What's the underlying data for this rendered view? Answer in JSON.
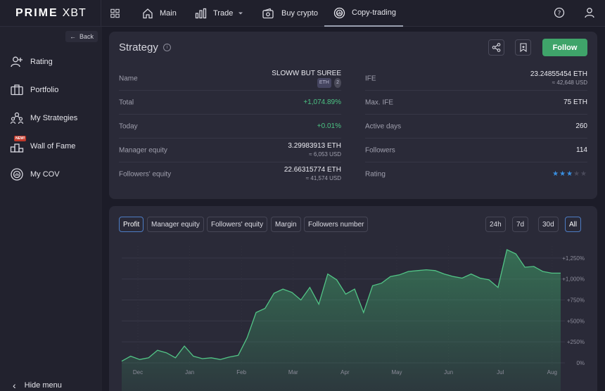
{
  "header": {
    "logo_left": "PRIME",
    "logo_right": "XBT",
    "nav": [
      {
        "label": "Main"
      },
      {
        "label": "Trade"
      },
      {
        "label": "Buy crypto"
      },
      {
        "label": "Copy-trading"
      }
    ]
  },
  "sidebar": {
    "back_label": "Back",
    "items": [
      {
        "label": "Rating"
      },
      {
        "label": "Portfolio"
      },
      {
        "label": "My Strategies"
      },
      {
        "label": "Wall of Fame",
        "badge": "NEW!"
      },
      {
        "label": "My COV"
      }
    ],
    "hide_menu": "Hide menu"
  },
  "strategy": {
    "title": "Strategy",
    "follow_label": "Follow",
    "left": [
      {
        "label": "Name",
        "value": "SLOWW BUT SUREE",
        "tags": [
          "ETH",
          "2"
        ]
      },
      {
        "label": "Total",
        "value": "+1,074.89%",
        "green": true
      },
      {
        "label": "Today",
        "value": "+0.01%",
        "green": true
      },
      {
        "label": "Manager equity",
        "value": "3.29983913 ETH",
        "sub": "≈ 6,053 USD"
      },
      {
        "label": "Followers' equity",
        "value": "22.66315774 ETH",
        "sub": "≈ 41,574 USD"
      }
    ],
    "right": [
      {
        "label": "IFE",
        "value": "23.24855454 ETH",
        "sub": "≈ 42,648 USD"
      },
      {
        "label": "Max. IFE",
        "value": "75 ETH"
      },
      {
        "label": "Active days",
        "value": "260"
      },
      {
        "label": "Followers",
        "value": "114"
      },
      {
        "label": "Rating",
        "stars": 3,
        "max_stars": 5
      }
    ]
  },
  "chart_tabs": {
    "metrics": [
      "Profit",
      "Manager equity",
      "Followers' equity",
      "Margin",
      "Followers number"
    ],
    "active_metric": "Profit",
    "ranges": [
      "24h",
      "7d",
      "30d",
      "All"
    ],
    "active_range": "All"
  },
  "chart_data": {
    "type": "area",
    "y_unit": "%",
    "ylim": [
      0,
      1350
    ],
    "y_ticks": [
      0,
      250,
      500,
      750,
      1000,
      1250
    ],
    "y_tick_labels": [
      "0%",
      "+250%",
      "+500%",
      "+750%",
      "+1,000%",
      "+1,250%"
    ],
    "x_tick_labels": [
      "Dec",
      "Jan",
      "Feb",
      "Mar",
      "Apr",
      "May",
      "Jun",
      "Jul",
      "Aug"
    ],
    "grid": true,
    "color": "#3fa46a",
    "x": [
      "Nov 20",
      "Nov 25",
      "Nov 30",
      "Dec 4",
      "Dec 8",
      "Dec 12",
      "Dec 16",
      "Dec 20",
      "Dec 24",
      "Dec 28",
      "Jan 1",
      "Jan 5",
      "Jan 9",
      "Jan 13",
      "Jan 17",
      "Jan 21",
      "Jan 25",
      "Jan 29",
      "Feb 2",
      "Feb 6",
      "Feb 10",
      "Feb 14",
      "Feb 18",
      "Feb 22",
      "Feb 26",
      "Mar 2",
      "Mar 6",
      "Mar 10",
      "Mar 14",
      "Mar 18",
      "Mar 22",
      "Mar 26",
      "Mar 30",
      "Apr 5",
      "Apr 15",
      "Apr 25",
      "May 5",
      "May 15",
      "May 25",
      "Jun 5",
      "Jun 15",
      "Jun 22",
      "Jun 28",
      "Jul 2",
      "Jul 6",
      "Jul 10",
      "Jul 20",
      "Aug 1",
      "Aug 10",
      "Aug 16"
    ],
    "values": [
      20,
      80,
      40,
      60,
      150,
      120,
      60,
      200,
      80,
      50,
      60,
      40,
      70,
      90,
      300,
      600,
      650,
      830,
      880,
      840,
      750,
      900,
      700,
      1060,
      990,
      820,
      880,
      600,
      920,
      950,
      1030,
      1050,
      1090,
      1100,
      1110,
      1100,
      1060,
      1030,
      1010,
      1060,
      1010,
      990,
      900,
      1350,
      1300,
      1140,
      1150,
      1090,
      1070,
      1070
    ]
  }
}
